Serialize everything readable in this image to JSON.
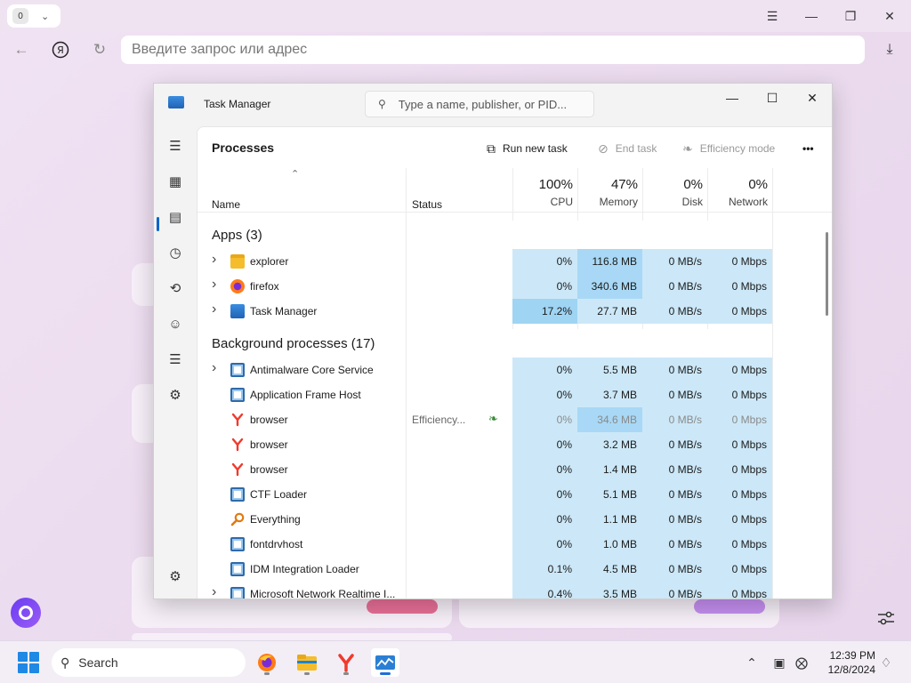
{
  "browser": {
    "tab_counter": "0",
    "address_placeholder": "Введите запрос или адрес"
  },
  "taskmanager": {
    "title": "Task Manager",
    "search_placeholder": "Type a name, publisher, or PID...",
    "page_title": "Processes",
    "toolbar": {
      "run_new_task": "Run new task",
      "end_task": "End task",
      "efficiency_mode": "Efficiency mode",
      "more": "•••"
    },
    "columns": {
      "name": "Name",
      "status": "Status",
      "cpu_pct": "100%",
      "cpu_label": "CPU",
      "mem_pct": "47%",
      "mem_label": "Memory",
      "disk_pct": "0%",
      "disk_label": "Disk",
      "net_pct": "0%",
      "net_label": "Network"
    },
    "groups": {
      "apps": "Apps (3)",
      "background": "Background processes (17)"
    },
    "apps": [
      {
        "name": "explorer",
        "icon": "folder-icon",
        "expandable": true,
        "status": "",
        "cpu": "0%",
        "memory": "116.8 MB",
        "disk": "0 MB/s",
        "network": "0 Mbps"
      },
      {
        "name": "firefox",
        "icon": "firefox-icon",
        "expandable": true,
        "status": "",
        "cpu": "0%",
        "memory": "340.6 MB",
        "disk": "0 MB/s",
        "network": "0 Mbps"
      },
      {
        "name": "Task Manager",
        "icon": "taskmanager-icon",
        "expandable": true,
        "status": "",
        "cpu": "17.2%",
        "memory": "27.7 MB",
        "disk": "0 MB/s",
        "network": "0 Mbps"
      }
    ],
    "background": [
      {
        "name": "Antimalware Core Service",
        "icon": "app-window-icon",
        "expandable": true,
        "status": "",
        "cpu": "0%",
        "memory": "5.5 MB",
        "disk": "0 MB/s",
        "network": "0 Mbps"
      },
      {
        "name": "Application Frame Host",
        "icon": "app-window-icon",
        "expandable": false,
        "status": "",
        "cpu": "0%",
        "memory": "3.7 MB",
        "disk": "0 MB/s",
        "network": "0 Mbps"
      },
      {
        "name": "browser",
        "icon": "yandex-icon",
        "expandable": false,
        "status": "Efficiency...",
        "efficiency": true,
        "cpu": "0%",
        "memory": "34.6 MB",
        "disk": "0 MB/s",
        "network": "0 Mbps"
      },
      {
        "name": "browser",
        "icon": "yandex-icon",
        "expandable": false,
        "status": "",
        "cpu": "0%",
        "memory": "3.2 MB",
        "disk": "0 MB/s",
        "network": "0 Mbps"
      },
      {
        "name": "browser",
        "icon": "yandex-icon",
        "expandable": false,
        "status": "",
        "cpu": "0%",
        "memory": "1.4 MB",
        "disk": "0 MB/s",
        "network": "0 Mbps"
      },
      {
        "name": "CTF Loader",
        "icon": "app-window-icon",
        "expandable": false,
        "status": "",
        "cpu": "0%",
        "memory": "5.1 MB",
        "disk": "0 MB/s",
        "network": "0 Mbps"
      },
      {
        "name": "Everything",
        "icon": "magnifier-icon",
        "expandable": false,
        "status": "",
        "cpu": "0%",
        "memory": "1.1 MB",
        "disk": "0 MB/s",
        "network": "0 Mbps"
      },
      {
        "name": "fontdrvhost",
        "icon": "app-window-icon",
        "expandable": false,
        "status": "",
        "cpu": "0%",
        "memory": "1.0 MB",
        "disk": "0 MB/s",
        "network": "0 Mbps"
      },
      {
        "name": "IDM Integration Loader",
        "icon": "app-window-icon",
        "expandable": false,
        "status": "",
        "cpu": "0.1%",
        "memory": "4.5 MB",
        "disk": "0 MB/s",
        "network": "0 Mbps"
      },
      {
        "name": "Microsoft Network Realtime I...",
        "icon": "app-window-icon",
        "expandable": true,
        "status": "",
        "cpu": "0.4%",
        "memory": "3.5 MB",
        "disk": "0 MB/s",
        "network": "0 Mbps"
      }
    ]
  },
  "taskbar": {
    "search_label": "Search",
    "time": "12:39 PM",
    "date": "12/8/2024"
  },
  "colors": {
    "cpu_light": "#cce8f8",
    "cpu_hot": "#9fd4f3",
    "mem_light": "#cce8f8",
    "mem_hot": "#a8d8f5",
    "accent": "#0a64c8"
  }
}
